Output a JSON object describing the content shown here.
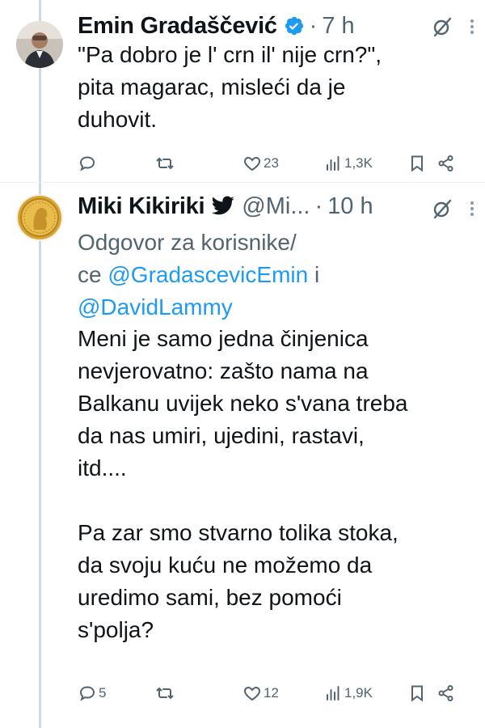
{
  "tweets": [
    {
      "author_name": "Emin Gradaščević",
      "verified": true,
      "time": "7 h",
      "text": "\"Pa dobro je l' crn il' nije crn?\",\npita magarac, misleći da je\nduhovit.",
      "actions": {
        "replies": "",
        "retweets": "",
        "likes": "23",
        "views": "1,3K"
      }
    },
    {
      "author_name": "Miki Kikiriki",
      "handle": "@Mi...",
      "time": "10 h",
      "reply_prefix": "Odgovor za korisnike/\nce",
      "mention1": "@GradascevicEmin",
      "reply_join": "i",
      "mention2": "@DavidLammy",
      "text": "Meni je samo jedna činjenica\nnevjerovatno: zašto nama na\nBalkanu uvijek neko s'vana treba\nda nas umiri, ujedini, rastavi,\nitd....\n\nPa zar smo stvarno tolika stoka,\nda svoju kuću ne možemo da\nuredimo sami, bez pomoći\ns'polja?",
      "actions": {
        "replies": "5",
        "retweets": "",
        "likes": "12",
        "views": "1,9K"
      }
    }
  ],
  "colors": {
    "accent": "#1d9bf0",
    "secondary_text": "#536471",
    "thread_line": "#cfd9de"
  },
  "icons": [
    "verified-badge-icon",
    "bird-icon",
    "grok-icon",
    "more-icon",
    "reply-icon",
    "retweet-icon",
    "like-icon",
    "views-icon",
    "bookmark-icon",
    "share-icon"
  ]
}
